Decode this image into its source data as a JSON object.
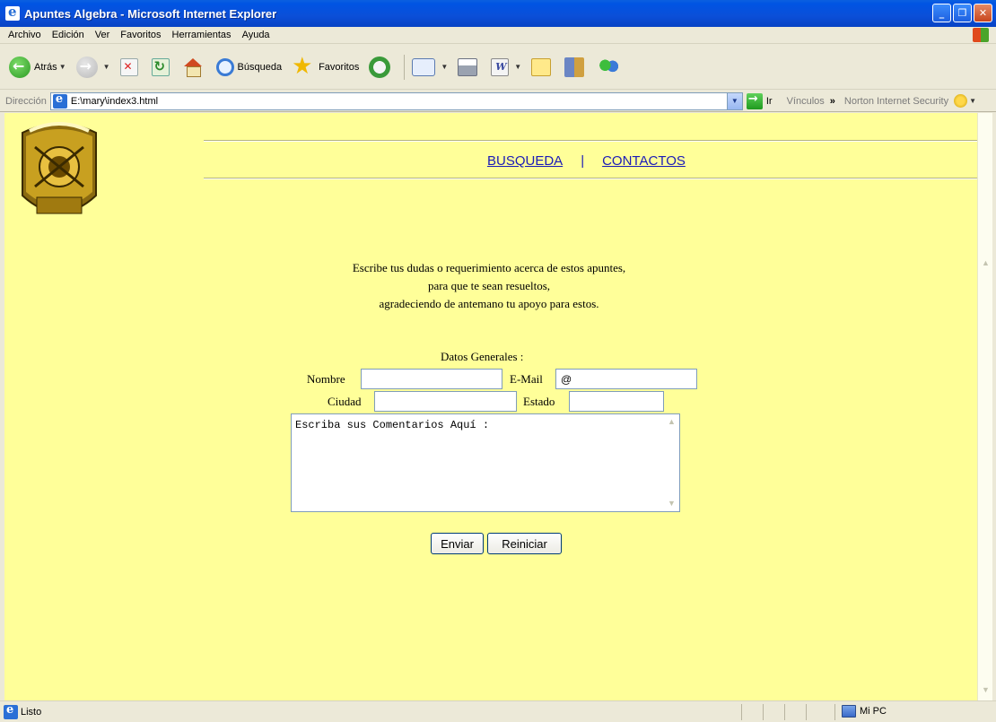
{
  "window": {
    "title": "Apuntes Algebra - Microsoft Internet Explorer",
    "buttons": [
      "_",
      "❐",
      "✕"
    ]
  },
  "menu": [
    "Archivo",
    "Edición",
    "Ver",
    "Favoritos",
    "Herramientas",
    "Ayuda"
  ],
  "toolbar": {
    "back_label": "Atrás",
    "search_label": "Búsqueda",
    "favorites_label": "Favoritos"
  },
  "address": {
    "label": "Dirección",
    "url": "E:\\mary\\index3.html",
    "go_label": "Ir",
    "links_label": "Vínculos",
    "links_chevron": "»",
    "norton_label": "Norton Internet Security"
  },
  "page": {
    "nav_links": [
      "BUSQUEDA",
      "CONTACTOS"
    ],
    "nav_separator": "|",
    "intro_lines": [
      "Escribe tus dudas o requerimiento acerca de estos apuntes,",
      "para que te sean resueltos,",
      "agradeciendo de antemano tu apoyo para estos."
    ],
    "form_title": "Datos Generales :",
    "labels": {
      "nombre": "Nombre",
      "email": "E-Mail",
      "ciudad": "Ciudad",
      "estado": "Estado"
    },
    "values": {
      "nombre": "",
      "email": "@",
      "ciudad": "",
      "estado": ""
    },
    "comments": "Escriba sus Comentarios Aquí :",
    "submit_label": "Enviar",
    "reset_label": "Reiniciar"
  },
  "status": {
    "text": "Listo",
    "zone": "Mi PC"
  },
  "colors": {
    "page_background": "#ffff99",
    "link": "#1a1ab8",
    "titlebar": "#0054e3"
  }
}
